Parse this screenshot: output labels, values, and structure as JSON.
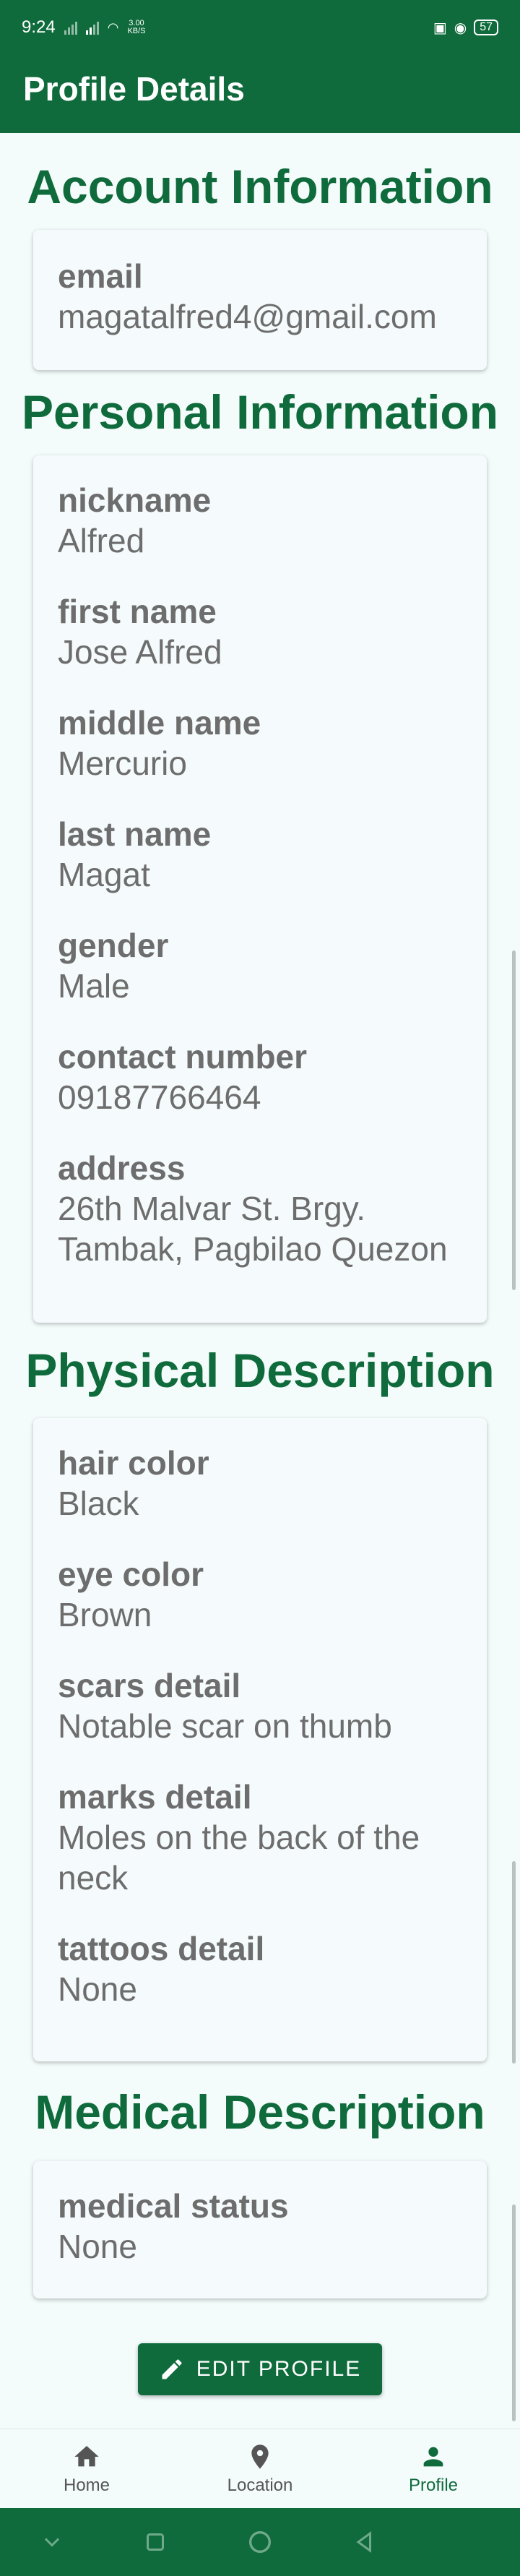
{
  "status_bar": {
    "time": "9:24",
    "net_speed": "3.00",
    "net_unit": "KB/S",
    "battery": "57"
  },
  "app_bar": {
    "title": "Profile Details"
  },
  "sections": {
    "account": {
      "title": "Account Information",
      "fields": [
        {
          "label": "email",
          "value": "magatalfred4@gmail.com"
        }
      ]
    },
    "personal": {
      "title": "Personal Information",
      "fields": [
        {
          "label": "nickname",
          "value": "Alfred"
        },
        {
          "label": "first name",
          "value": "Jose Alfred"
        },
        {
          "label": "middle name",
          "value": "Mercurio"
        },
        {
          "label": "last name",
          "value": "Magat"
        },
        {
          "label": "gender",
          "value": "Male"
        },
        {
          "label": "contact number",
          "value": "09187766464"
        },
        {
          "label": "address",
          "value_line1": "26th Malvar St. Brgy.",
          "value_line2": "Tambak, Pagbilao Quezon"
        }
      ]
    },
    "physical": {
      "title": "Physical Description",
      "fields": [
        {
          "label": "hair color",
          "value": "Black"
        },
        {
          "label": "eye color",
          "value": "Brown"
        },
        {
          "label": "scars detail",
          "value": "Notable scar on thumb"
        },
        {
          "label": "marks detail",
          "value_line1": "Moles on the back of the",
          "value_line2": "neck"
        },
        {
          "label": "tattoos detail",
          "value": "None"
        }
      ]
    },
    "medical": {
      "title": "Medical Description",
      "fields": [
        {
          "label": "medical status",
          "value": "None"
        }
      ]
    }
  },
  "edit_button": {
    "label": "EDIT PROFILE",
    "icon": "pencil-icon"
  },
  "bottom_nav": {
    "items": [
      {
        "label": "Home",
        "icon": "home-icon"
      },
      {
        "label": "Location",
        "icon": "location-pin-icon"
      },
      {
        "label": "Profile",
        "icon": "person-icon",
        "active": true
      }
    ]
  },
  "colors": {
    "primary": "#0f6b3c",
    "background": "#f4fbfb"
  }
}
